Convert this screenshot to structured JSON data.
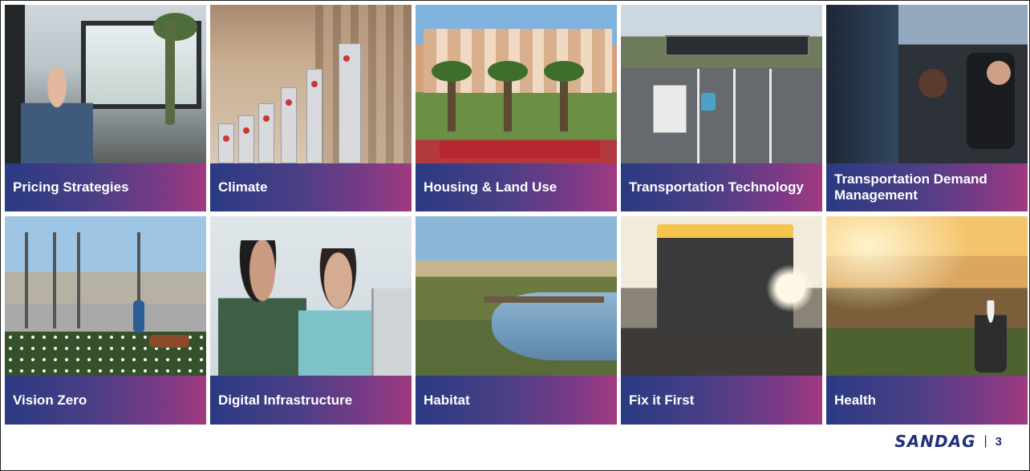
{
  "tiles": [
    {
      "label": "Pricing Strategies"
    },
    {
      "label": "Climate"
    },
    {
      "label": "Housing & Land Use"
    },
    {
      "label": "Transportation Technology"
    },
    {
      "label": "Transportation Demand Management"
    },
    {
      "label": "Vision Zero"
    },
    {
      "label": "Digital Infrastructure"
    },
    {
      "label": "Habitat"
    },
    {
      "label": "Fix it First"
    },
    {
      "label": "Health"
    }
  ],
  "footer": {
    "logo_text": "SANDAG",
    "separator": "|",
    "page_number": "3"
  },
  "colors": {
    "caption_gradient_start": "#2a3a82",
    "caption_gradient_end": "#a13a80",
    "brand": "#23307a"
  }
}
